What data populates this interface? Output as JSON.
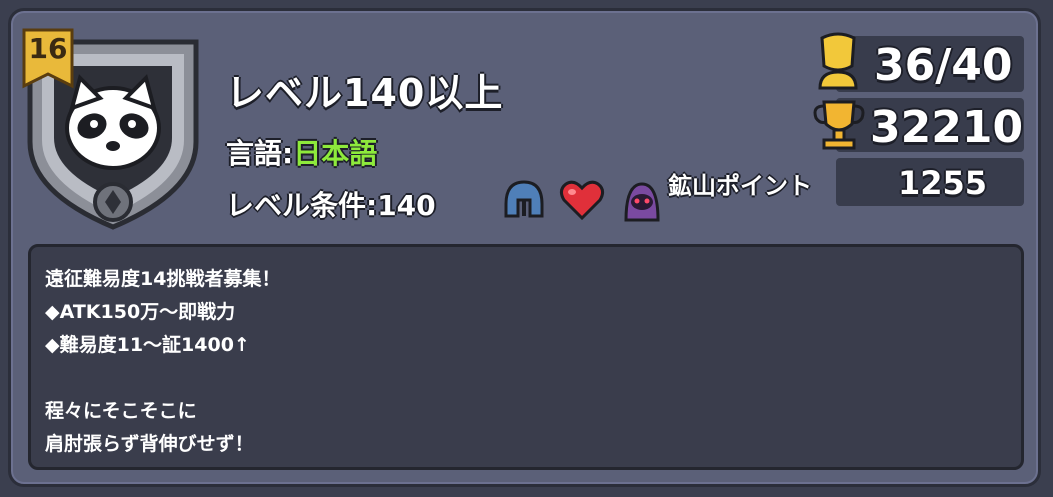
{
  "profile": {
    "level_badge": "16",
    "title": "レベル140以上",
    "language_label": "言語:",
    "language_value": "日本語",
    "level_condition": "レベル条件:140"
  },
  "icons": [
    "raccoon-emblem-icon",
    "helmet-icon",
    "heart-icon",
    "ghost-icon",
    "trophy-icon"
  ],
  "stats": {
    "members": "36/40",
    "trophies": "32210",
    "mine_label": "鉱山ポイント",
    "mine_points": "1255"
  },
  "message": {
    "lines": [
      "遠征難易度14挑戦者募集！",
      "◆ATK150万〜即戦力",
      "◆難易度11〜証1400↑",
      "",
      "程々にそこそこに",
      "肩肘張らず背伸びせず！"
    ]
  },
  "colors": {
    "panel": "#5b6078",
    "message_box": "#3a3d4c",
    "language_value": "#8eea3c",
    "badge_gold": "#e9b93a"
  }
}
